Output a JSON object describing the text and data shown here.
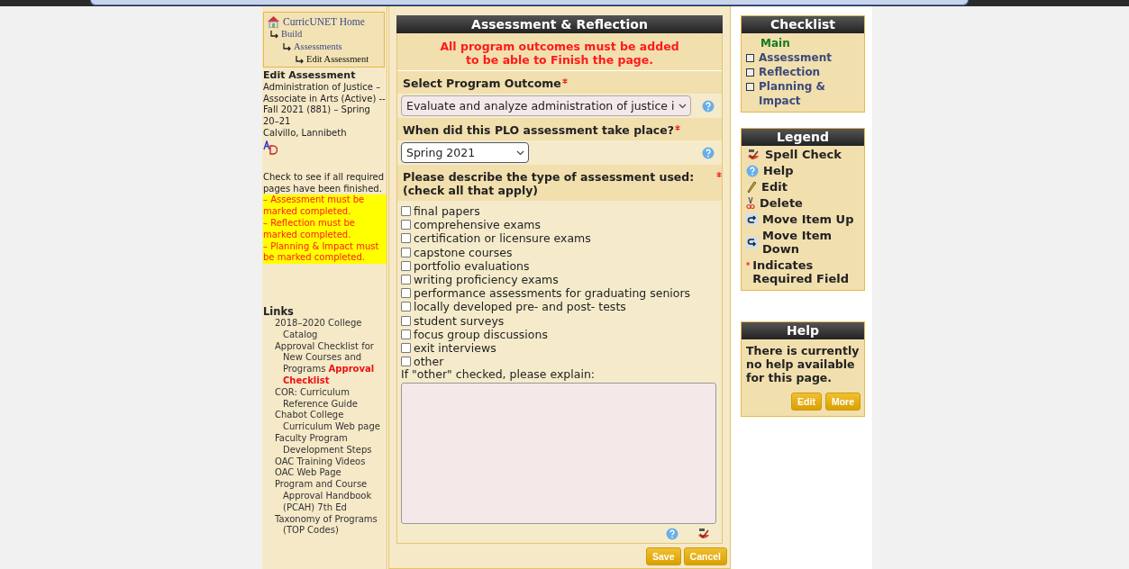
{
  "breadcrumb": {
    "label": "CurricUNET Home",
    "children": [
      {
        "label": "Build",
        "children": [
          {
            "label": "Assessments",
            "children": [
              {
                "label": "Edit Assessment"
              }
            ]
          }
        ]
      }
    ]
  },
  "sidebar": {
    "title": "Edit Assessment",
    "details": "Administration of Justice – Associate in Arts (Active) -- Fall 2021 (881) – Spring 20–21",
    "author": "Calvillo, Lannibeth",
    "check_note": "Check to see if all required pages have been finished.",
    "warnings": [
      "– Assessment must be marked completed.",
      "– Reflection must be marked completed.",
      "– Planning & Impact must be marked completed."
    ],
    "links_title": "Links",
    "links": [
      "2018–2020 College Catalog",
      "Approval Checklist for New Courses and Programs **Approval Checklist**",
      "COR: Curriculum Reference Guide",
      "Chabot College Curriculum Web page",
      "Faculty Program Development Steps",
      "OAC Training Videos",
      "OAC Web Page",
      "Program and Course Approval Handbook (PCAH) 7th Ed",
      "Taxonomy of Programs (TOP Codes)"
    ]
  },
  "form": {
    "title": "Assessment & Reflection",
    "notice": "All program outcomes must be added to be able to Finish the page.",
    "outcome": {
      "label": "Select Program Outcome",
      "required": true,
      "value": "Evaluate and analyze administration of justice i"
    },
    "when": {
      "label": "When did this PLO assessment take place?",
      "required": true,
      "value": "Spring 2021"
    },
    "types": {
      "label": "Please describe the type of assessment used: (check all that apply)",
      "required": true,
      "options": [
        {
          "label": "final papers",
          "checked": false
        },
        {
          "label": "comprehensive exams",
          "checked": false
        },
        {
          "label": "certification or licensure exams",
          "checked": false
        },
        {
          "label": "capstone courses",
          "checked": false
        },
        {
          "label": "portfolio evaluations",
          "checked": false
        },
        {
          "label": "writing proficiency exams",
          "checked": false
        },
        {
          "label": "performance assessments for graduating seniors",
          "checked": false
        },
        {
          "label": "locally developed pre- and post- tests",
          "checked": false
        },
        {
          "label": "student surveys",
          "checked": false
        },
        {
          "label": "focus group discussions",
          "checked": false
        },
        {
          "label": "exit interviews",
          "checked": false
        },
        {
          "label": "other",
          "checked": false
        }
      ]
    },
    "explain_label": "If \"other\" checked, please explain:",
    "buttons": [
      "Save",
      "Cancel"
    ]
  },
  "checklist": {
    "title": "Checklist",
    "items": [
      {
        "label": "Main",
        "kind": "current"
      },
      {
        "label": "Assessment",
        "kind": "page",
        "checked": false
      },
      {
        "label": "Reflection",
        "kind": "page",
        "checked": false
      },
      {
        "label": "Planning & Impact",
        "kind": "page",
        "checked": false
      }
    ]
  },
  "legend": {
    "title": "Legend",
    "items": [
      {
        "label": "Spell Check",
        "kind": "spell"
      },
      {
        "label": "Help",
        "kind": "help"
      },
      {
        "label": "Edit",
        "kind": "edit"
      },
      {
        "label": "Delete",
        "kind": "delete"
      },
      {
        "label": "Move Item Up",
        "kind": "up"
      },
      {
        "label": "Move Item Down",
        "kind": "down"
      },
      {
        "label": "Indicates Required Field",
        "kind": "required"
      }
    ]
  },
  "help": {
    "title": "Help",
    "text": "There is currently no help available for this page.",
    "buttons": [
      "Edit",
      "More"
    ]
  }
}
